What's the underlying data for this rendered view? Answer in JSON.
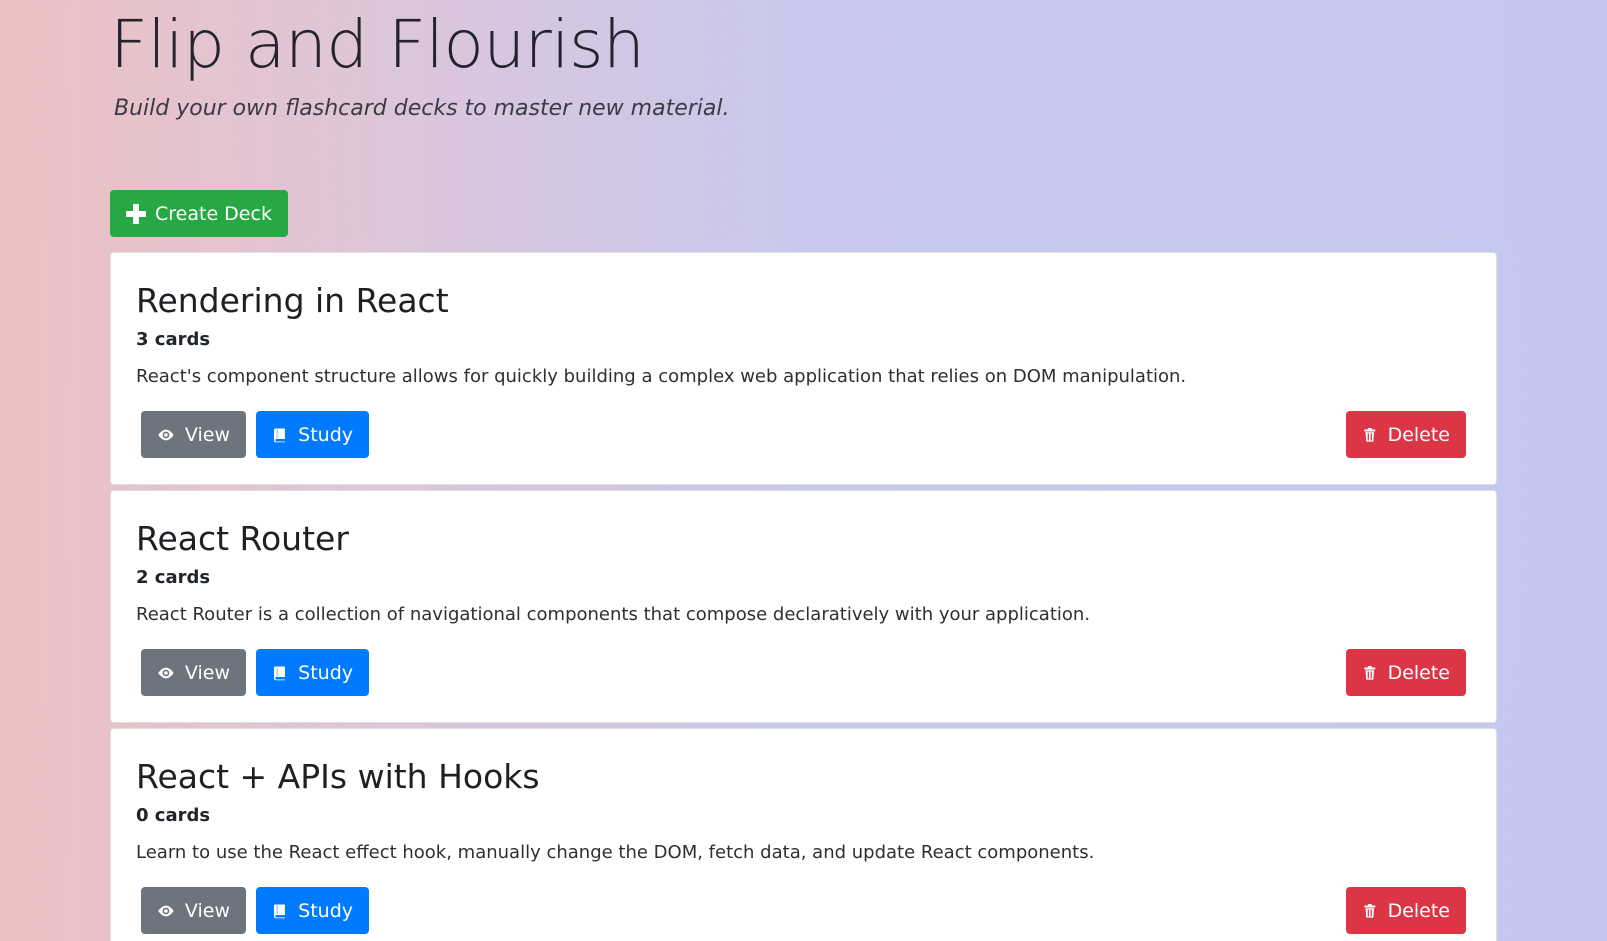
{
  "app": {
    "title": "Flip and Flourish",
    "subtitle": "Build your own flashcard decks to master new material."
  },
  "toolbar": {
    "create_label": "Create Deck",
    "create_icon": "plus-icon"
  },
  "colors": {
    "success": "#28a745",
    "primary": "#007bff",
    "secondary": "#6c757d",
    "danger": "#dc3545"
  },
  "decks": [
    {
      "name": "Rendering in React",
      "count": "3 cards",
      "description": "React's component structure allows for quickly building a complex web application that relies on DOM manipulation.",
      "view_label": "View",
      "study_label": "Study",
      "delete_label": "Delete"
    },
    {
      "name": "React Router",
      "count": "2 cards",
      "description": "React Router is a collection of navigational components that compose declaratively with your application.",
      "view_label": "View",
      "study_label": "Study",
      "delete_label": "Delete"
    },
    {
      "name": "React + APIs with Hooks",
      "count": "0 cards",
      "description": "Learn to use the React effect hook, manually change the DOM, fetch data, and update React components.",
      "view_label": "View",
      "study_label": "Study",
      "delete_label": "Delete"
    }
  ]
}
